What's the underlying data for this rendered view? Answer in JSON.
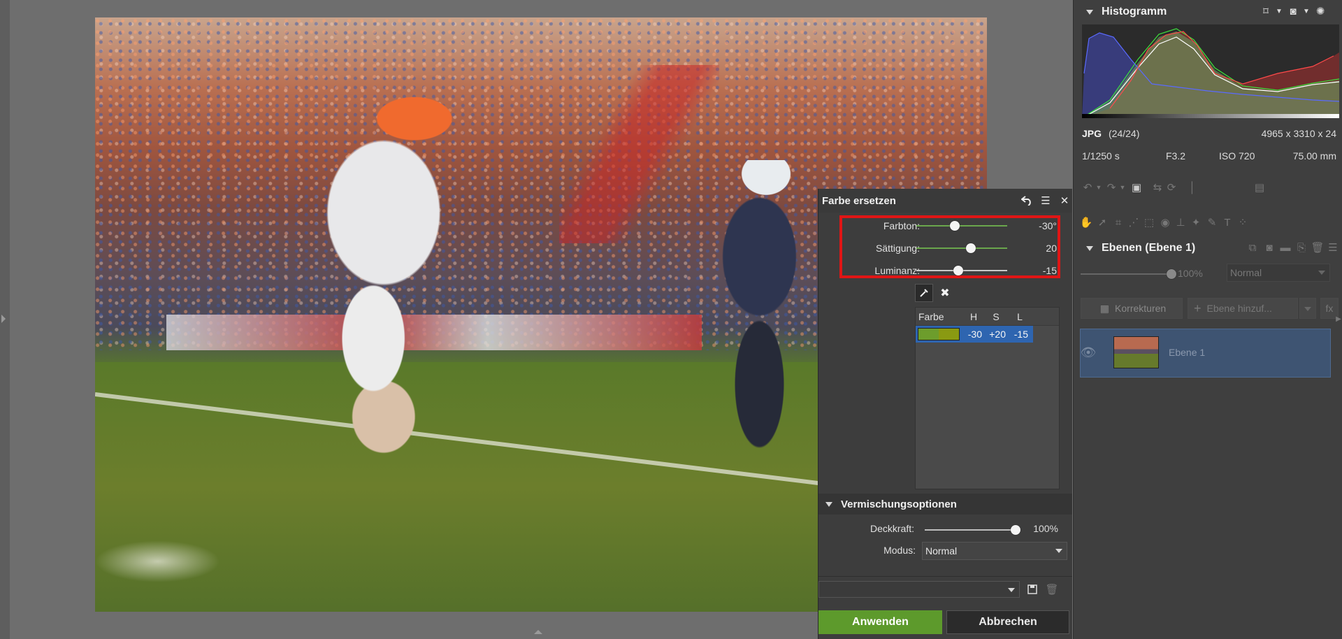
{
  "dialog": {
    "title": "Farbe ersetzen",
    "sliders": [
      {
        "label": "Farbton:",
        "value": "-30°",
        "fraction": 0.42
      },
      {
        "label": "Sättigung:",
        "value": "20",
        "fraction": 0.6
      },
      {
        "label": "Luminanz:",
        "value": "-15",
        "fraction": 0.46
      }
    ],
    "table": {
      "headers": [
        "Farbe",
        "H",
        "S",
        "L"
      ],
      "rows": [
        {
          "h": "-30",
          "s": "+20",
          "l": "-15"
        }
      ]
    },
    "blend_title": "Vermischungsoptionen",
    "opacity_label": "Deckkraft:",
    "opacity_value": "100%",
    "opacity_fraction": 1.0,
    "mode_label": "Modus:",
    "mode_value": "Normal",
    "apply_label": "Anwenden",
    "cancel_label": "Abbrechen"
  },
  "panel": {
    "histogram_title": "Histogramm",
    "format": "JPG",
    "count": "(24/24)",
    "dimensions": "4965 x 3310 x 24",
    "shutter": "1/1250 s",
    "aperture": "F3.2",
    "iso": "ISO 720",
    "focal": "75.00 mm",
    "save_label": "Speichern",
    "layers_title": "Ebenen (Ebene 1)",
    "layer_opacity": "100%",
    "layer_opacity_fraction": 1.0,
    "layer_mode": "Normal",
    "corrections_label": "Korrekturen",
    "add_layer_label": "Ebene hinzuf...",
    "fx_label": "fx",
    "layer_name": "Ebene 1"
  },
  "colors": {
    "apply": "#5d9a2c",
    "highlight_box": "#e01515",
    "selected_row": "#2e65b0",
    "layer_selected": "#3e5472"
  }
}
